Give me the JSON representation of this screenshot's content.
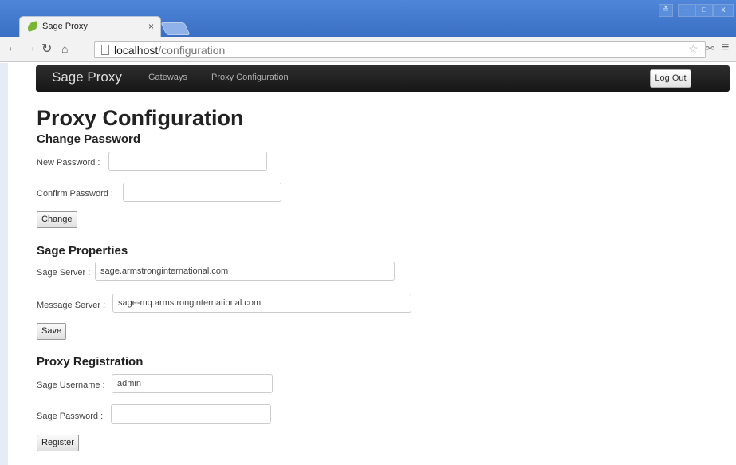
{
  "browser": {
    "tab_title": "Sage Proxy",
    "tab_close": "×",
    "url_host": "localhost",
    "url_path": "/configuration",
    "window_controls": [
      "≛",
      "–",
      "□",
      "x"
    ]
  },
  "navbar": {
    "brand": "Sage Proxy",
    "links": [
      "Gateways",
      "Proxy Configuration"
    ],
    "logout": "Log Out"
  },
  "page_title": "Proxy Configuration",
  "change_password": {
    "heading": "Change Password",
    "new_password_label": "New Password :",
    "new_password_value": "",
    "confirm_password_label": "Confirm Password :",
    "confirm_password_value": "",
    "button": "Change"
  },
  "sage_properties": {
    "heading": "Sage Properties",
    "server_label": "Sage Server :",
    "server_value": "sage.armstronginternational.com",
    "message_server_label": "Message Server :",
    "message_server_value": "sage-mq.armstronginternational.com",
    "button": "Save"
  },
  "proxy_registration": {
    "heading": "Proxy Registration",
    "username_label": "Sage Username :",
    "username_value": "admin",
    "password_label": "Sage Password :",
    "password_value": "",
    "button": "Register"
  },
  "colors": {
    "titlebar": "#3a6fc4",
    "navbar": "#1f1f1f"
  }
}
